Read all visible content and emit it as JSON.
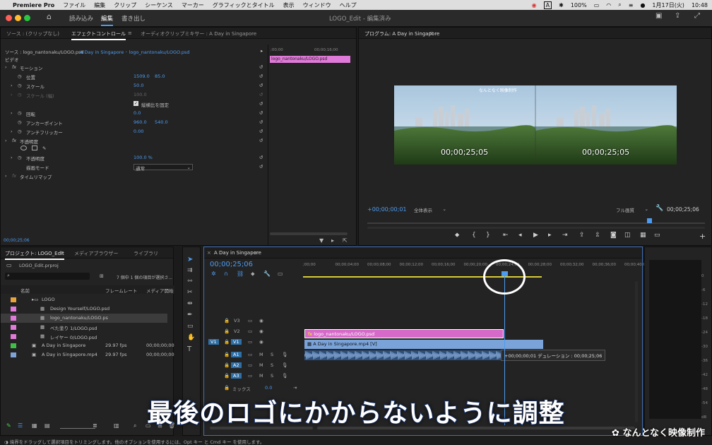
{
  "menubar": {
    "app": "Premiere Pro",
    "items": [
      "ファイル",
      "編集",
      "クリップ",
      "シーケンス",
      "マーカー",
      "グラフィックとタイトル",
      "表示",
      "ウィンドウ",
      "ヘルプ"
    ],
    "battery": "100%",
    "datetime": "1月17日(火)",
    "time": "10:48",
    "input_mode": "A"
  },
  "title": {
    "workspaces": [
      "読み込み",
      "編集",
      "書き出し"
    ],
    "window_title": "LOGO_Edit - 編集済み"
  },
  "effect_panel": {
    "tabs": [
      "ソース : (クリップなし)",
      "エフェクトコントロール",
      "オーディオクリップミキサー : A Day in Singapore"
    ],
    "clip_path": "ソース : logo_nantonaku/LOGO.psd",
    "sequence_path": "A Day in Singapore ･ logo_nantonaku/LOGO.psd",
    "mini_time_start": ";00;00",
    "mini_time_end": "00;00;16;00",
    "mini_clip": "logo_nantonaku/LOGO.psd",
    "video_label": "ビデオ",
    "motion": "モーション",
    "position": "位置",
    "position_x": "1509.0",
    "position_y": "85.0",
    "scale": "スケール",
    "scale_val": "50.0",
    "scale_w": "スケール (幅)",
    "scale_w_val": "100.0",
    "uniform": "縦横比を固定",
    "rotation": "回転",
    "rotation_val": "0.0",
    "anchor": "アンカーポイント",
    "anchor_x": "960.0",
    "anchor_y": "540.0",
    "flicker": "アンチフリッカー",
    "flicker_val": "0.00",
    "opacity_group": "不透明度",
    "opacity": "不透明度",
    "opacity_val": "100.0 %",
    "blend": "描画モード",
    "blend_val": "通常",
    "timeremap": "タイムリマップ",
    "timecode": "00;00;25;06"
  },
  "program": {
    "title": "プログラム: A Day in Singapore",
    "timecode_left": "+00;00;00;01",
    "fit": "全体表示",
    "quality": "フル画質",
    "timecode_right": "00;00;25;06",
    "overlay_tc1": "00;00;25;05",
    "overlay_tc2": "00;00;25;05",
    "watermark": "なんとなく映像制作"
  },
  "project": {
    "tabs": [
      "プロジェクト: LOGO_Edit",
      "メディアブラウザー",
      "ライブラリ"
    ],
    "file": "LOGO_Edit.prproj",
    "count": "7 個中 1 個の項目が選択さ...",
    "cols": [
      "名前",
      "フレームレート",
      "メディア開始"
    ],
    "rows": [
      {
        "name": "LOGO",
        "fps": "",
        "start": "",
        "color": "#e8a33c"
      },
      {
        "name": "Design Yourself/LOGO.psd",
        "fps": "",
        "start": "",
        "color": "#e07ad8"
      },
      {
        "name": "logo_nantonaku/LOGO.ps",
        "fps": "",
        "start": "",
        "color": "#e07ad8"
      },
      {
        "name": "べた塗り 1/LOGO.psd",
        "fps": "",
        "start": "",
        "color": "#e07ad8"
      },
      {
        "name": "レイヤー 0/LOGO.psd",
        "fps": "",
        "start": "",
        "color": "#e07ad8"
      },
      {
        "name": "A Day in Singapore",
        "fps": "29.97 fps",
        "start": "00;00;00;00",
        "color": "#3fbf4a"
      },
      {
        "name": "A Day in Singapore.mp4",
        "fps": "29.97 fps",
        "start": "00;00;00;00",
        "color": "#7fa3d8"
      }
    ]
  },
  "timeline": {
    "tab": "A Day in Singapore",
    "timecode": "00;00;25;06",
    "ticks": [
      ";00;00",
      "00;00;04;00",
      "00;00;08;00",
      "00;00;12;00",
      "00;00;16;00",
      "00;00;20;00",
      "00;00;24;00",
      "00;00;28;00",
      "00;00;32;00",
      "00;00;36;00",
      "00;00;40;0"
    ],
    "tracks_v": [
      "V3",
      "V2",
      "V1"
    ],
    "tracks_a": [
      "A1",
      "A2",
      "A3"
    ],
    "src_v": "V1",
    "mix": "ミックス",
    "mix_val": "0.0",
    "clip_logo": "logo_nantonaku/LOGO.psd",
    "clip_video": "A Day in Singapore.mp4 [V]",
    "tooltip": "+00;00;00;01 デュレーション : 00;00;25;06"
  },
  "meter": {
    "ticks": [
      "0",
      "-6",
      "-12",
      "-18",
      "-24",
      "-30",
      "-36",
      "-42",
      "-48",
      "-54",
      "dB"
    ]
  },
  "caption": "最後のロゴにかからないように調整",
  "watermark_bottom": "なんとなく映像制作",
  "status": "境界をドラッグして選択項目をトリミングします。他のオプションを使用するには、Opt キー と Cmd キー を使用します。"
}
